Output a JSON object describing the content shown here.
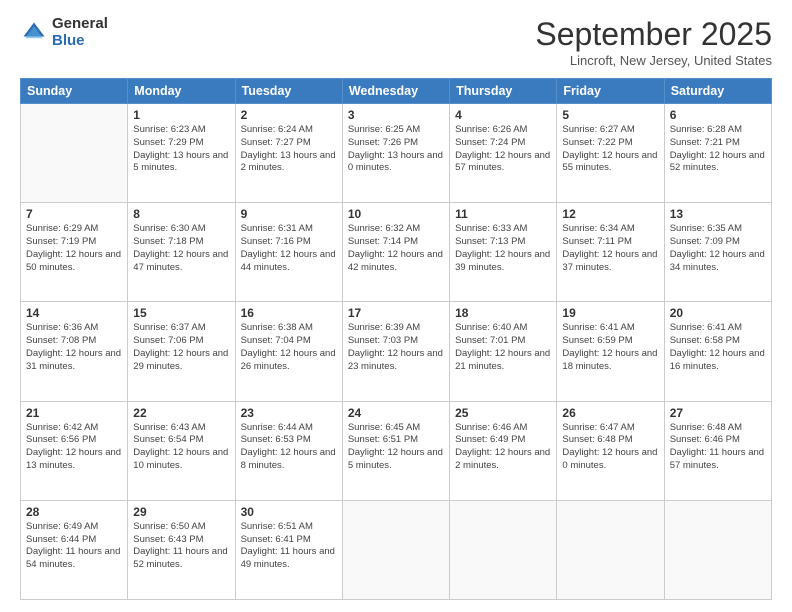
{
  "logo": {
    "general": "General",
    "blue": "Blue"
  },
  "header": {
    "title": "September 2025",
    "location": "Lincroft, New Jersey, United States"
  },
  "weekdays": [
    "Sunday",
    "Monday",
    "Tuesday",
    "Wednesday",
    "Thursday",
    "Friday",
    "Saturday"
  ],
  "weeks": [
    [
      {
        "day": null,
        "sunrise": null,
        "sunset": null,
        "daylight": null
      },
      {
        "day": "1",
        "sunrise": "6:23 AM",
        "sunset": "7:29 PM",
        "daylight": "13 hours and 5 minutes."
      },
      {
        "day": "2",
        "sunrise": "6:24 AM",
        "sunset": "7:27 PM",
        "daylight": "13 hours and 2 minutes."
      },
      {
        "day": "3",
        "sunrise": "6:25 AM",
        "sunset": "7:26 PM",
        "daylight": "13 hours and 0 minutes."
      },
      {
        "day": "4",
        "sunrise": "6:26 AM",
        "sunset": "7:24 PM",
        "daylight": "12 hours and 57 minutes."
      },
      {
        "day": "5",
        "sunrise": "6:27 AM",
        "sunset": "7:22 PM",
        "daylight": "12 hours and 55 minutes."
      },
      {
        "day": "6",
        "sunrise": "6:28 AM",
        "sunset": "7:21 PM",
        "daylight": "12 hours and 52 minutes."
      }
    ],
    [
      {
        "day": "7",
        "sunrise": "6:29 AM",
        "sunset": "7:19 PM",
        "daylight": "12 hours and 50 minutes."
      },
      {
        "day": "8",
        "sunrise": "6:30 AM",
        "sunset": "7:18 PM",
        "daylight": "12 hours and 47 minutes."
      },
      {
        "day": "9",
        "sunrise": "6:31 AM",
        "sunset": "7:16 PM",
        "daylight": "12 hours and 44 minutes."
      },
      {
        "day": "10",
        "sunrise": "6:32 AM",
        "sunset": "7:14 PM",
        "daylight": "12 hours and 42 minutes."
      },
      {
        "day": "11",
        "sunrise": "6:33 AM",
        "sunset": "7:13 PM",
        "daylight": "12 hours and 39 minutes."
      },
      {
        "day": "12",
        "sunrise": "6:34 AM",
        "sunset": "7:11 PM",
        "daylight": "12 hours and 37 minutes."
      },
      {
        "day": "13",
        "sunrise": "6:35 AM",
        "sunset": "7:09 PM",
        "daylight": "12 hours and 34 minutes."
      }
    ],
    [
      {
        "day": "14",
        "sunrise": "6:36 AM",
        "sunset": "7:08 PM",
        "daylight": "12 hours and 31 minutes."
      },
      {
        "day": "15",
        "sunrise": "6:37 AM",
        "sunset": "7:06 PM",
        "daylight": "12 hours and 29 minutes."
      },
      {
        "day": "16",
        "sunrise": "6:38 AM",
        "sunset": "7:04 PM",
        "daylight": "12 hours and 26 minutes."
      },
      {
        "day": "17",
        "sunrise": "6:39 AM",
        "sunset": "7:03 PM",
        "daylight": "12 hours and 23 minutes."
      },
      {
        "day": "18",
        "sunrise": "6:40 AM",
        "sunset": "7:01 PM",
        "daylight": "12 hours and 21 minutes."
      },
      {
        "day": "19",
        "sunrise": "6:41 AM",
        "sunset": "6:59 PM",
        "daylight": "12 hours and 18 minutes."
      },
      {
        "day": "20",
        "sunrise": "6:41 AM",
        "sunset": "6:58 PM",
        "daylight": "12 hours and 16 minutes."
      }
    ],
    [
      {
        "day": "21",
        "sunrise": "6:42 AM",
        "sunset": "6:56 PM",
        "daylight": "12 hours and 13 minutes."
      },
      {
        "day": "22",
        "sunrise": "6:43 AM",
        "sunset": "6:54 PM",
        "daylight": "12 hours and 10 minutes."
      },
      {
        "day": "23",
        "sunrise": "6:44 AM",
        "sunset": "6:53 PM",
        "daylight": "12 hours and 8 minutes."
      },
      {
        "day": "24",
        "sunrise": "6:45 AM",
        "sunset": "6:51 PM",
        "daylight": "12 hours and 5 minutes."
      },
      {
        "day": "25",
        "sunrise": "6:46 AM",
        "sunset": "6:49 PM",
        "daylight": "12 hours and 2 minutes."
      },
      {
        "day": "26",
        "sunrise": "6:47 AM",
        "sunset": "6:48 PM",
        "daylight": "12 hours and 0 minutes."
      },
      {
        "day": "27",
        "sunrise": "6:48 AM",
        "sunset": "6:46 PM",
        "daylight": "11 hours and 57 minutes."
      }
    ],
    [
      {
        "day": "28",
        "sunrise": "6:49 AM",
        "sunset": "6:44 PM",
        "daylight": "11 hours and 54 minutes."
      },
      {
        "day": "29",
        "sunrise": "6:50 AM",
        "sunset": "6:43 PM",
        "daylight": "11 hours and 52 minutes."
      },
      {
        "day": "30",
        "sunrise": "6:51 AM",
        "sunset": "6:41 PM",
        "daylight": "11 hours and 49 minutes."
      },
      {
        "day": null,
        "sunrise": null,
        "sunset": null,
        "daylight": null
      },
      {
        "day": null,
        "sunrise": null,
        "sunset": null,
        "daylight": null
      },
      {
        "day": null,
        "sunrise": null,
        "sunset": null,
        "daylight": null
      },
      {
        "day": null,
        "sunrise": null,
        "sunset": null,
        "daylight": null
      }
    ]
  ],
  "labels": {
    "sunrise": "Sunrise:",
    "sunset": "Sunset:",
    "daylight": "Daylight:"
  }
}
